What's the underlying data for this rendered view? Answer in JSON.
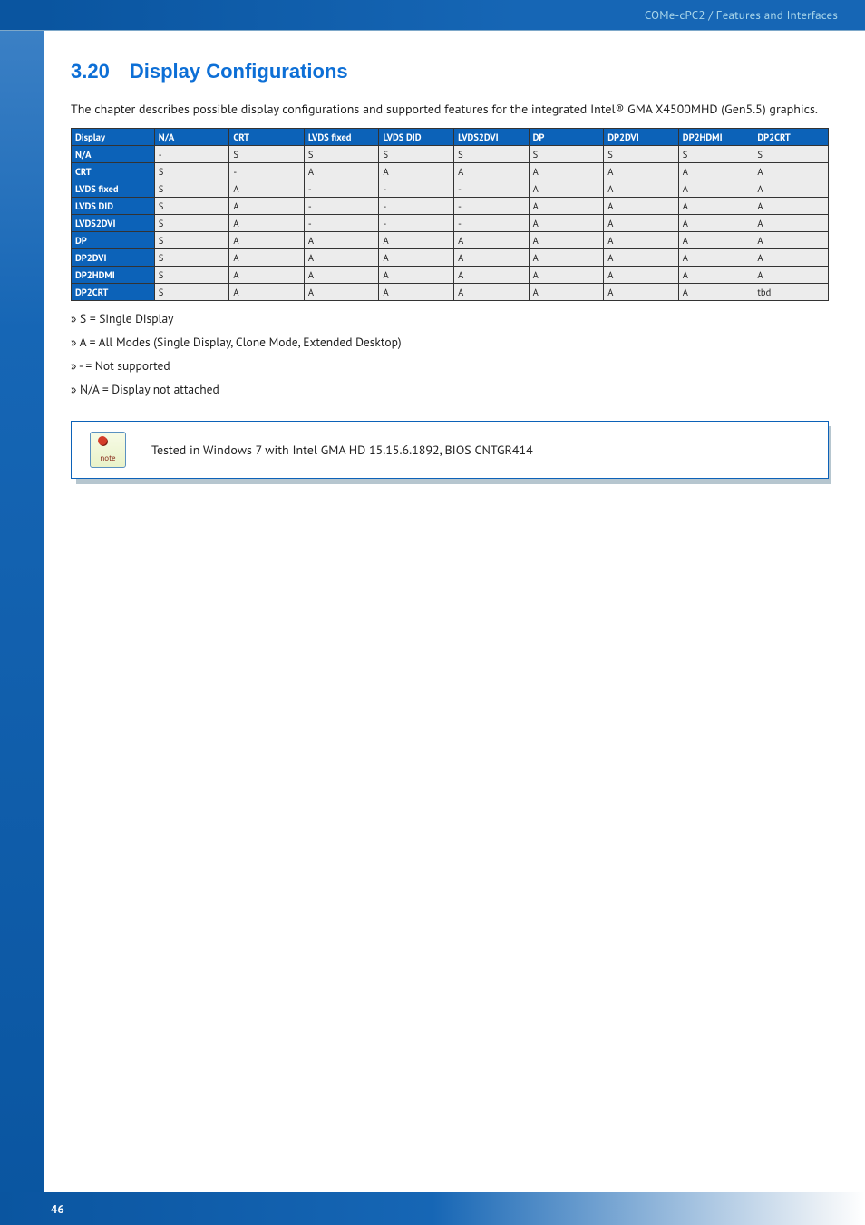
{
  "header": {
    "breadcrumb": "COMe-cPC2 / Features and Interfaces"
  },
  "section": {
    "number": "3.20",
    "title": "Display Configurations"
  },
  "intro": "The chapter describes possible display configurations and supported features for the integrated Intel® GMA X4500MHD (Gen5.5) graphics.",
  "table": {
    "columns": [
      "Display",
      "N/A",
      "CRT",
      "LVDS fixed",
      "LVDS DID",
      "LVDS2DVI",
      "DP",
      "DP2DVI",
      "DP2HDMI",
      "DP2CRT"
    ],
    "rows": [
      {
        "head": "N/A",
        "cells": [
          "-",
          "S",
          "S",
          "S",
          "S",
          "S",
          "S",
          "S",
          "S"
        ]
      },
      {
        "head": "CRT",
        "cells": [
          "S",
          "-",
          "A",
          "A",
          "A",
          "A",
          "A",
          "A",
          "A"
        ]
      },
      {
        "head": "LVDS fixed",
        "cells": [
          "S",
          "A",
          "-",
          "-",
          "-",
          "A",
          "A",
          "A",
          "A"
        ]
      },
      {
        "head": "LVDS DID",
        "cells": [
          "S",
          "A",
          "-",
          "-",
          "-",
          "A",
          "A",
          "A",
          "A"
        ]
      },
      {
        "head": "LVDS2DVI",
        "cells": [
          "S",
          "A",
          "-",
          "-",
          "-",
          "A",
          "A",
          "A",
          "A"
        ]
      },
      {
        "head": "DP",
        "cells": [
          "S",
          "A",
          "A",
          "A",
          "A",
          "A",
          "A",
          "A",
          "A"
        ]
      },
      {
        "head": "DP2DVI",
        "cells": [
          "S",
          "A",
          "A",
          "A",
          "A",
          "A",
          "A",
          "A",
          "A"
        ]
      },
      {
        "head": "DP2HDMI",
        "cells": [
          "S",
          "A",
          "A",
          "A",
          "A",
          "A",
          "A",
          "A",
          "A"
        ]
      },
      {
        "head": "DP2CRT",
        "cells": [
          "S",
          "A",
          "A",
          "A",
          "A",
          "A",
          "A",
          "A",
          "tbd"
        ]
      }
    ]
  },
  "legend": {
    "s": "» S = Single Display",
    "a": "» A = All Modes (Single Display, Clone Mode, Extended Desktop)",
    "dash": "» - = Not supported",
    "na": "» N/A = Display not attached"
  },
  "note": {
    "icon_label": "note",
    "text": "Tested in Windows 7 with Intel GMA HD 15.15.6.1892, BIOS CNTGR414"
  },
  "footer": {
    "page": "46"
  }
}
